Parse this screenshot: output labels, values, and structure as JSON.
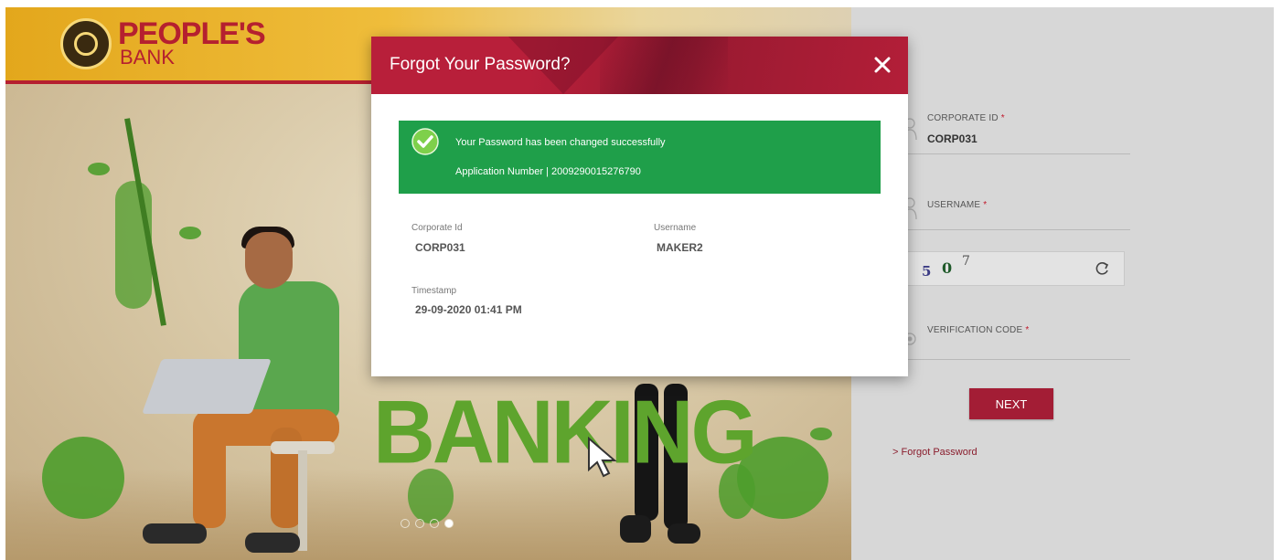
{
  "brand": {
    "name_line1": "PEOPLE'S",
    "name_line2": "BANK"
  },
  "hero": {
    "slogan": "BANKING",
    "carousel_count": 4,
    "carousel_active_index": 3
  },
  "login": {
    "corporate_id": {
      "label": "CORPORATE ID",
      "required_mark": "*",
      "value": "CORP031"
    },
    "username": {
      "label": "USERNAME",
      "required_mark": "*",
      "value": ""
    },
    "captcha": {
      "chars": [
        "5",
        "0",
        "7"
      ]
    },
    "verification_code": {
      "label": "VERIFICATION CODE",
      "required_mark": "*",
      "value": ""
    },
    "next_label": "NEXT",
    "forgot_link": "> Forgot Password"
  },
  "modal": {
    "title": "Forgot Your Password?",
    "close_symbol": "✕",
    "success_message": "Your Password has been changed successfully",
    "application_line": "Application Number | 2009290015276790",
    "details": {
      "corporate_id_label": "Corporate Id",
      "corporate_id_value": "CORP031",
      "username_label": "Username",
      "username_value": "MAKER2",
      "timestamp_label": "Timestamp",
      "timestamp_value": "29-09-2020 01:41 PM"
    }
  },
  "colors": {
    "brand_red": "#b5202f",
    "modal_header": "#b81f3a",
    "success_green": "#1f9f4a",
    "next_button": "#a31d35",
    "login_panel_bg": "#d7d7d7"
  }
}
